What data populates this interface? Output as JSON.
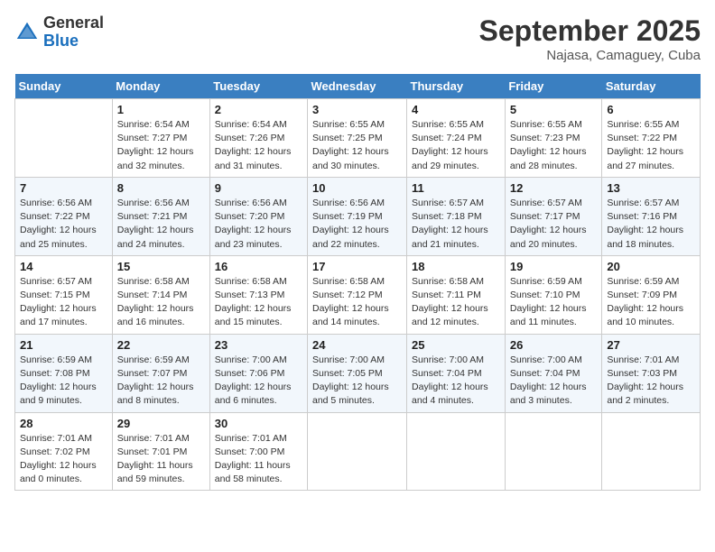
{
  "header": {
    "logo_general": "General",
    "logo_blue": "Blue",
    "month": "September 2025",
    "location": "Najasa, Camaguey, Cuba"
  },
  "weekdays": [
    "Sunday",
    "Monday",
    "Tuesday",
    "Wednesday",
    "Thursday",
    "Friday",
    "Saturday"
  ],
  "weeks": [
    [
      {
        "day": "",
        "info": ""
      },
      {
        "day": "1",
        "info": "Sunrise: 6:54 AM\nSunset: 7:27 PM\nDaylight: 12 hours\nand 32 minutes."
      },
      {
        "day": "2",
        "info": "Sunrise: 6:54 AM\nSunset: 7:26 PM\nDaylight: 12 hours\nand 31 minutes."
      },
      {
        "day": "3",
        "info": "Sunrise: 6:55 AM\nSunset: 7:25 PM\nDaylight: 12 hours\nand 30 minutes."
      },
      {
        "day": "4",
        "info": "Sunrise: 6:55 AM\nSunset: 7:24 PM\nDaylight: 12 hours\nand 29 minutes."
      },
      {
        "day": "5",
        "info": "Sunrise: 6:55 AM\nSunset: 7:23 PM\nDaylight: 12 hours\nand 28 minutes."
      },
      {
        "day": "6",
        "info": "Sunrise: 6:55 AM\nSunset: 7:22 PM\nDaylight: 12 hours\nand 27 minutes."
      }
    ],
    [
      {
        "day": "7",
        "info": "Sunrise: 6:56 AM\nSunset: 7:22 PM\nDaylight: 12 hours\nand 25 minutes."
      },
      {
        "day": "8",
        "info": "Sunrise: 6:56 AM\nSunset: 7:21 PM\nDaylight: 12 hours\nand 24 minutes."
      },
      {
        "day": "9",
        "info": "Sunrise: 6:56 AM\nSunset: 7:20 PM\nDaylight: 12 hours\nand 23 minutes."
      },
      {
        "day": "10",
        "info": "Sunrise: 6:56 AM\nSunset: 7:19 PM\nDaylight: 12 hours\nand 22 minutes."
      },
      {
        "day": "11",
        "info": "Sunrise: 6:57 AM\nSunset: 7:18 PM\nDaylight: 12 hours\nand 21 minutes."
      },
      {
        "day": "12",
        "info": "Sunrise: 6:57 AM\nSunset: 7:17 PM\nDaylight: 12 hours\nand 20 minutes."
      },
      {
        "day": "13",
        "info": "Sunrise: 6:57 AM\nSunset: 7:16 PM\nDaylight: 12 hours\nand 18 minutes."
      }
    ],
    [
      {
        "day": "14",
        "info": "Sunrise: 6:57 AM\nSunset: 7:15 PM\nDaylight: 12 hours\nand 17 minutes."
      },
      {
        "day": "15",
        "info": "Sunrise: 6:58 AM\nSunset: 7:14 PM\nDaylight: 12 hours\nand 16 minutes."
      },
      {
        "day": "16",
        "info": "Sunrise: 6:58 AM\nSunset: 7:13 PM\nDaylight: 12 hours\nand 15 minutes."
      },
      {
        "day": "17",
        "info": "Sunrise: 6:58 AM\nSunset: 7:12 PM\nDaylight: 12 hours\nand 14 minutes."
      },
      {
        "day": "18",
        "info": "Sunrise: 6:58 AM\nSunset: 7:11 PM\nDaylight: 12 hours\nand 12 minutes."
      },
      {
        "day": "19",
        "info": "Sunrise: 6:59 AM\nSunset: 7:10 PM\nDaylight: 12 hours\nand 11 minutes."
      },
      {
        "day": "20",
        "info": "Sunrise: 6:59 AM\nSunset: 7:09 PM\nDaylight: 12 hours\nand 10 minutes."
      }
    ],
    [
      {
        "day": "21",
        "info": "Sunrise: 6:59 AM\nSunset: 7:08 PM\nDaylight: 12 hours\nand 9 minutes."
      },
      {
        "day": "22",
        "info": "Sunrise: 6:59 AM\nSunset: 7:07 PM\nDaylight: 12 hours\nand 8 minutes."
      },
      {
        "day": "23",
        "info": "Sunrise: 7:00 AM\nSunset: 7:06 PM\nDaylight: 12 hours\nand 6 minutes."
      },
      {
        "day": "24",
        "info": "Sunrise: 7:00 AM\nSunset: 7:05 PM\nDaylight: 12 hours\nand 5 minutes."
      },
      {
        "day": "25",
        "info": "Sunrise: 7:00 AM\nSunset: 7:04 PM\nDaylight: 12 hours\nand 4 minutes."
      },
      {
        "day": "26",
        "info": "Sunrise: 7:00 AM\nSunset: 7:04 PM\nDaylight: 12 hours\nand 3 minutes."
      },
      {
        "day": "27",
        "info": "Sunrise: 7:01 AM\nSunset: 7:03 PM\nDaylight: 12 hours\nand 2 minutes."
      }
    ],
    [
      {
        "day": "28",
        "info": "Sunrise: 7:01 AM\nSunset: 7:02 PM\nDaylight: 12 hours\nand 0 minutes."
      },
      {
        "day": "29",
        "info": "Sunrise: 7:01 AM\nSunset: 7:01 PM\nDaylight: 11 hours\nand 59 minutes."
      },
      {
        "day": "30",
        "info": "Sunrise: 7:01 AM\nSunset: 7:00 PM\nDaylight: 11 hours\nand 58 minutes."
      },
      {
        "day": "",
        "info": ""
      },
      {
        "day": "",
        "info": ""
      },
      {
        "day": "",
        "info": ""
      },
      {
        "day": "",
        "info": ""
      }
    ]
  ]
}
